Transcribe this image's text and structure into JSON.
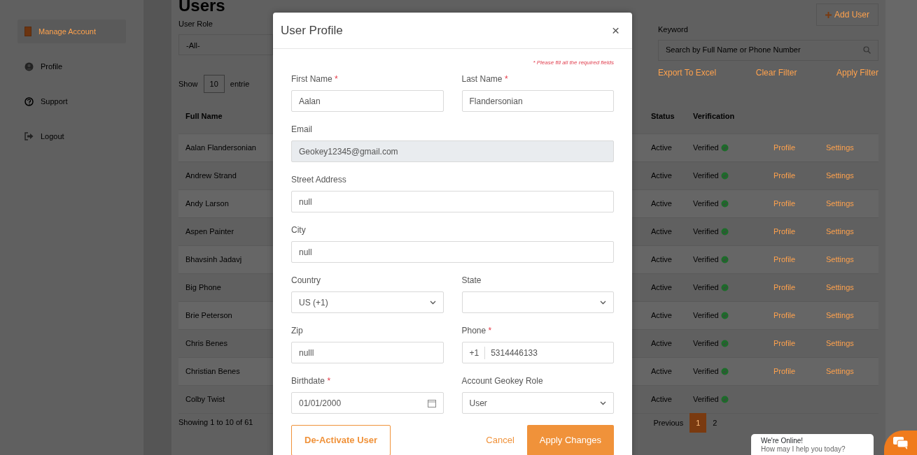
{
  "sidebar": {
    "items": [
      {
        "label": "Manage Account",
        "selected": true
      },
      {
        "label": "Profile",
        "selected": false
      },
      {
        "label": "Support",
        "selected": false
      },
      {
        "label": "Logout",
        "selected": false
      }
    ]
  },
  "page": {
    "title": "Users",
    "add_user": "Add User",
    "filters": {
      "role_label": "User Role",
      "role_value": "-All-",
      "keyword_label": "Keyword",
      "keyword_placeholder": "Search by Full Name or Phone Number",
      "links": [
        "Export To Excel",
        "Clear Filter",
        "Apply Filter"
      ]
    },
    "entries": {
      "show": "Show",
      "count": "10",
      "suffix": "entrie"
    },
    "table": {
      "columns": [
        "Full Name",
        "Status",
        "Verification"
      ],
      "rows": [
        {
          "name": "Aalan Flandersonian",
          "status": "Active",
          "verification": "Verified",
          "profile": "Profile",
          "settings": "Settings"
        },
        {
          "name": "Andrew Strand",
          "status": "Active",
          "verification": "Verified",
          "profile": "Profile",
          "settings": "Settings"
        },
        {
          "name": "Andy Larson",
          "status": "Active",
          "verification": "Verified",
          "profile": "Profile",
          "settings": "Settings"
        },
        {
          "name": "Aspen Painter",
          "status": "Active",
          "verification": "Verified",
          "profile": "Profile",
          "settings": "Settings"
        },
        {
          "name": "Bhavsinh Jadavj",
          "status": "Active",
          "verification": "Verified",
          "profile": "Profile",
          "settings": "Settings"
        },
        {
          "name": "Big Phone",
          "status": "Active",
          "verification": "Verified",
          "profile": "Profile",
          "settings": "Settings"
        },
        {
          "name": "Brie Peterson",
          "status": "Active",
          "verification": "Verified",
          "profile": "Profile",
          "settings": "Settings"
        },
        {
          "name": "Chris Benes",
          "status": "Active",
          "verification": "Verified",
          "profile": "Profile",
          "settings": "Settings"
        },
        {
          "name": "Christian Benes",
          "status": "Active",
          "verification": "Verified",
          "profile": "Profile",
          "settings": "Settings"
        },
        {
          "name": "Colby Twist",
          "status": "Active",
          "verification": "Verified"
        }
      ]
    },
    "footer": "Showing 1 to 10 of 61",
    "pagination": [
      {
        "label": "Previous",
        "selected": false
      },
      {
        "label": "1",
        "selected": true
      },
      {
        "label": "2",
        "selected": false
      }
    ]
  },
  "modal": {
    "title": "User Profile",
    "close": "×",
    "required_note": "* Please fill all the required fields",
    "rows": [
      [
        {
          "label": "First Name",
          "required_mark": "*",
          "kind": "text",
          "value": "Aalan"
        },
        {
          "label": "Last Name",
          "required_mark": "*",
          "kind": "text",
          "value": "Flandersonian"
        }
      ],
      [
        {
          "label": "Email",
          "kind": "text",
          "value": "Geokey12345@gmail.com",
          "disabled": true
        }
      ],
      [
        {
          "label": "Street Address",
          "kind": "text",
          "value": "null"
        }
      ],
      [
        {
          "label": "City",
          "kind": "text",
          "value": "null"
        }
      ],
      [
        {
          "label": "Country",
          "kind": "select",
          "value": "US (+1)"
        },
        {
          "label": "State",
          "kind": "select"
        }
      ],
      [
        {
          "label": "Zip",
          "kind": "text",
          "value": "nulll"
        },
        {
          "label": "Phone",
          "required_mark": "*",
          "kind": "phone",
          "prefix": "+1",
          "value": "5314446133"
        }
      ],
      [
        {
          "label": "Birthdate",
          "required_mark": "*",
          "kind": "date",
          "value": "01/01/2000"
        },
        {
          "label": "Account Geokey Role",
          "kind": "select",
          "value": "User"
        }
      ]
    ],
    "buttons": {
      "deactivate": "De-Activate User",
      "cancel": "Cancel",
      "apply": "Apply Changes"
    }
  },
  "chat": {
    "title": "We're Online!",
    "subtitle": "How may I help you today?"
  }
}
